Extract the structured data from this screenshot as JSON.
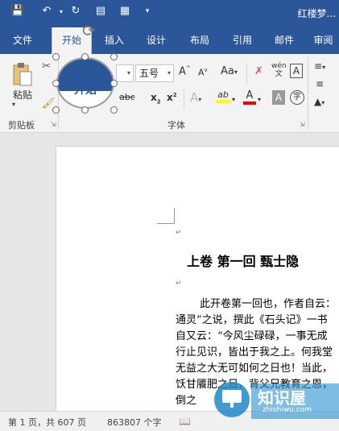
{
  "title_bar": {
    "doc_title": "红楼梦..."
  },
  "tabs": [
    {
      "label": "文件"
    },
    {
      "label": "开始"
    },
    {
      "label": "插入"
    },
    {
      "label": "设计"
    },
    {
      "label": "布局"
    },
    {
      "label": "引用"
    },
    {
      "label": "邮件"
    },
    {
      "label": "审阅"
    }
  ],
  "clipboard": {
    "paste_label": "粘贴",
    "group_label": "剪贴板"
  },
  "font": {
    "size_value": "五号",
    "group_label": "字体",
    "grow": "A",
    "shrink": "A",
    "case": "Aa",
    "wen": "wén",
    "strike": "abc",
    "sub": "x",
    "sup": "x",
    "effects": "A",
    "highlight": "ab",
    "color": "A",
    "shade": "A",
    "circle": "字"
  },
  "magnifier": {
    "label": "开始"
  },
  "document": {
    "heading": "上卷  第一回    甄士隐",
    "lines": [
      "此开卷第一回也，作者自云：",
      "通灵”之说，撰此《石头记》一书",
      "自又云：“今风尘碌碌，一事无成",
      "行止见识，皆出于我之上。何我堂",
      "无益之大无可如何之日也！当此，",
      "饫甘餍肥之日，背父兄教育之恩，",
      "倒之"
    ],
    "para_mark": "↵"
  },
  "status": {
    "page": "第 1 页，共 607 页",
    "words": "863807 个字"
  },
  "watermark": {
    "text": "知识屋",
    "url": "zhishiwu.com"
  },
  "colors": {
    "accent": "#2b579a"
  }
}
